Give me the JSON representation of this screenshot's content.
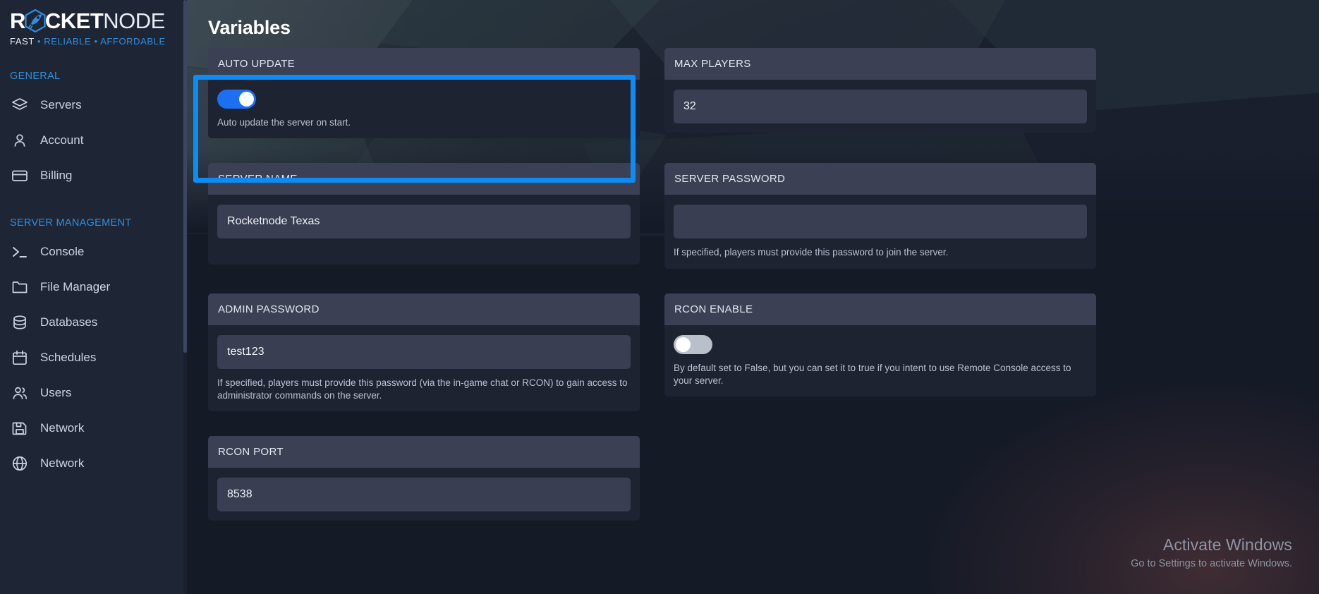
{
  "brand": {
    "name_part1": "R",
    "name_hex": "O",
    "name_part2": "CKET",
    "name_part3": "NODE",
    "tagline_1": "FAST",
    "tagline_dot1": "•",
    "tagline_2": "RELIABLE",
    "tagline_dot2": "•",
    "tagline_3": "AFFORDABLE",
    "accent_color": "#2f8fe0"
  },
  "sidebar": {
    "sections": [
      {
        "title": "GENERAL",
        "items": [
          {
            "label": "Servers",
            "icon": "layers-icon"
          },
          {
            "label": "Account",
            "icon": "user-icon"
          },
          {
            "label": "Billing",
            "icon": "credit-card-icon"
          }
        ]
      },
      {
        "title": "SERVER MANAGEMENT",
        "items": [
          {
            "label": "Console",
            "icon": "terminal-icon"
          },
          {
            "label": "File Manager",
            "icon": "folder-icon"
          },
          {
            "label": "Databases",
            "icon": "database-icon"
          },
          {
            "label": "Schedules",
            "icon": "calendar-icon"
          },
          {
            "label": "Users",
            "icon": "users-icon"
          },
          {
            "label": "Network",
            "icon": "globe-icon"
          }
        ]
      }
    ]
  },
  "main": {
    "title": "Variables",
    "highlight_color": "#0d8cf5",
    "cards": {
      "auto_update": {
        "label": "AUTO UPDATE",
        "toggle_state": "on",
        "help": "Auto update the server on start."
      },
      "max_players": {
        "label": "MAX PLAYERS",
        "value": "32",
        "help": ""
      },
      "server_name": {
        "label": "SERVER NAME",
        "value": "Rocketnode Texas",
        "help": ""
      },
      "server_password": {
        "label": "SERVER PASSWORD",
        "value": "",
        "help": "If specified, players must provide this password to join the server."
      },
      "admin_password": {
        "label": "ADMIN PASSWORD",
        "value": "test123",
        "help": "If specified, players must provide this password (via the in-game chat or RCON) to gain access to administrator commands on the server."
      },
      "rcon_enable": {
        "label": "RCON ENABLE",
        "toggle_state": "off",
        "help": "By default set to False, but you can set it to true if you intent to use Remote Console access to your server."
      },
      "rcon_port": {
        "label": "RCON PORT",
        "value": "8538",
        "help": ""
      }
    }
  },
  "watermark": {
    "title": "Activate Windows",
    "subtitle": "Go to Settings to activate Windows."
  }
}
